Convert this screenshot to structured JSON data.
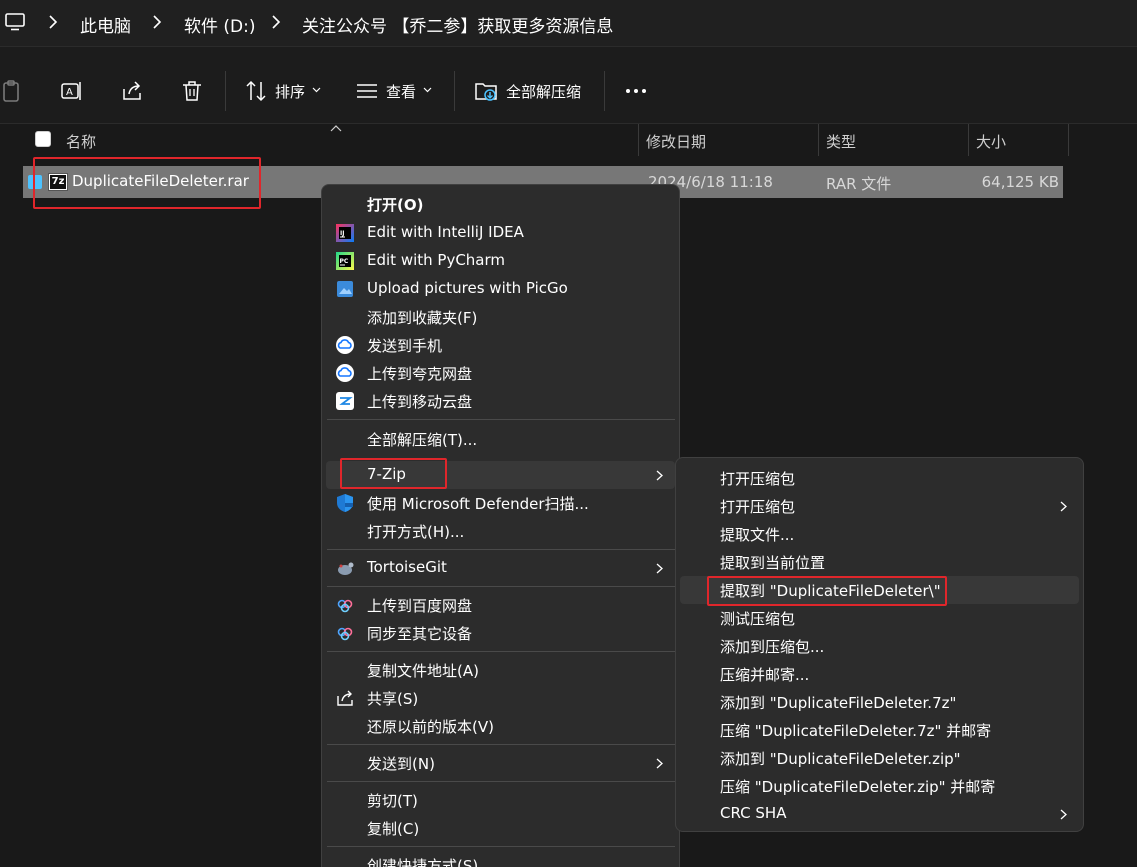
{
  "breadcrumb": {
    "items": [
      "此电脑",
      "软件 (D:)",
      "关注公众号 【乔二参】获取更多资源信息"
    ]
  },
  "toolbar": {
    "sort_label": "排序",
    "view_label": "查看",
    "extract_all_label": "全部解压缩"
  },
  "columns": {
    "name": "名称",
    "modified": "修改日期",
    "type": "类型",
    "size": "大小"
  },
  "file": {
    "icon_text": "7z",
    "name": "DuplicateFileDeleter.rar",
    "modified": "2024/6/18 11:18",
    "type": "RAR 文件",
    "size": "64,125 KB"
  },
  "context_menu": {
    "items": [
      {
        "label": "打开(O)"
      },
      {
        "label": "Edit with IntelliJ IDEA",
        "icon": "intellij-icon"
      },
      {
        "label": "Edit with PyCharm",
        "icon": "pycharm-icon"
      },
      {
        "label": "Upload pictures with PicGo",
        "icon": "picgo-icon"
      },
      {
        "label": "添加到收藏夹(F)"
      },
      {
        "label": "发送到手机",
        "icon": "quark-cloud-icon"
      },
      {
        "label": "上传到夸克网盘",
        "icon": "quark-cloud-icon"
      },
      {
        "label": "上传到移动云盘",
        "icon": "mobile-cloud-icon"
      },
      {
        "label": "全部解压缩(T)..."
      },
      {
        "label": "7-Zip"
      },
      {
        "label": "使用 Microsoft Defender扫描...",
        "icon": "defender-shield-icon"
      },
      {
        "label": "打开方式(H)..."
      },
      {
        "label": "TortoiseGit",
        "icon": "tortoisegit-icon"
      },
      {
        "label": "上传到百度网盘",
        "icon": "baidu-cloud-icon"
      },
      {
        "label": "同步至其它设备",
        "icon": "baidu-cloud-icon"
      },
      {
        "label": "复制文件地址(A)"
      },
      {
        "label": "共享(S)",
        "icon": "share-icon"
      },
      {
        "label": "还原以前的版本(V)"
      },
      {
        "label": "发送到(N)"
      },
      {
        "label": "剪切(T)"
      },
      {
        "label": "复制(C)"
      },
      {
        "label": "创建快捷方式(S)"
      }
    ]
  },
  "submenu_7zip": {
    "items": [
      {
        "label": "打开压缩包"
      },
      {
        "label": "打开压缩包"
      },
      {
        "label": "提取文件..."
      },
      {
        "label": "提取到当前位置"
      },
      {
        "label": "提取到 \"DuplicateFileDeleter\\\""
      },
      {
        "label": "测试压缩包"
      },
      {
        "label": "添加到压缩包..."
      },
      {
        "label": "压缩并邮寄..."
      },
      {
        "label": "添加到 \"DuplicateFileDeleter.7z\""
      },
      {
        "label": "压缩 \"DuplicateFileDeleter.7z\" 并邮寄"
      },
      {
        "label": "添加到 \"DuplicateFileDeleter.zip\""
      },
      {
        "label": "压缩 \"DuplicateFileDeleter.zip\" 并邮寄"
      },
      {
        "label": "CRC SHA"
      }
    ]
  },
  "colors": {
    "highlight_box": "#e0262b",
    "selection_row": "#777777",
    "menu_bg": "#2c2c2c",
    "accent": "#4cc2ff"
  }
}
